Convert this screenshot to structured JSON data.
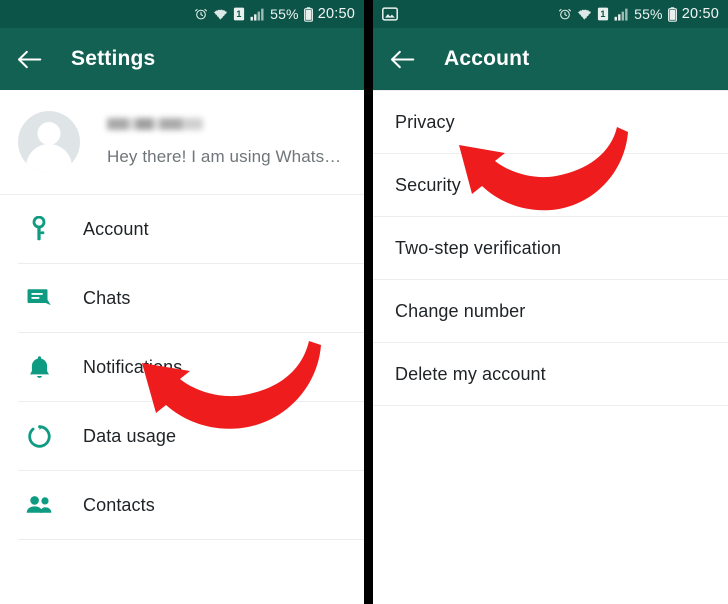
{
  "accent": {
    "statusbar_bg": "#0d5448",
    "appbar_bg": "#136153",
    "icon_green": "#0f9b81",
    "arrow_red": "#ee1c1c",
    "text_primary": "#1f2326",
    "text_secondary": "#6f7679"
  },
  "status_bar": {
    "alarm_icon": "alarm-clock-icon",
    "wifi_icon": "wifi-icon",
    "sim_icon": "sim-card-1-icon",
    "sim_label": "1",
    "signal_icon": "cellular-signal-icon",
    "battery_percent": "55%",
    "battery_icon": "battery-icon",
    "time": "20:50",
    "screenshot_icon": "screenshot-image-icon"
  },
  "left_screen": {
    "appbar": {
      "back_icon": "back-arrow-icon",
      "title": "Settings"
    },
    "profile": {
      "avatar_icon": "default-avatar-icon",
      "name": "",
      "status": "Hey there! I am using Whats…"
    },
    "items": [
      {
        "label": "Account",
        "icon": "key-icon"
      },
      {
        "label": "Chats",
        "icon": "chat-bubble-icon"
      },
      {
        "label": "Notifications",
        "icon": "bell-icon"
      },
      {
        "label": "Data usage",
        "icon": "data-usage-circle-icon"
      },
      {
        "label": "Contacts",
        "icon": "contacts-people-icon"
      }
    ],
    "annotation": {
      "icon": "red-curved-arrow-icon",
      "points_to": "Account"
    }
  },
  "right_screen": {
    "appbar": {
      "back_icon": "back-arrow-icon",
      "title": "Account"
    },
    "items": [
      {
        "label": "Privacy"
      },
      {
        "label": "Security"
      },
      {
        "label": "Two-step verification"
      },
      {
        "label": "Change number"
      },
      {
        "label": "Delete my account"
      }
    ],
    "annotation": {
      "icon": "red-curved-arrow-icon",
      "points_to": "Privacy"
    }
  }
}
